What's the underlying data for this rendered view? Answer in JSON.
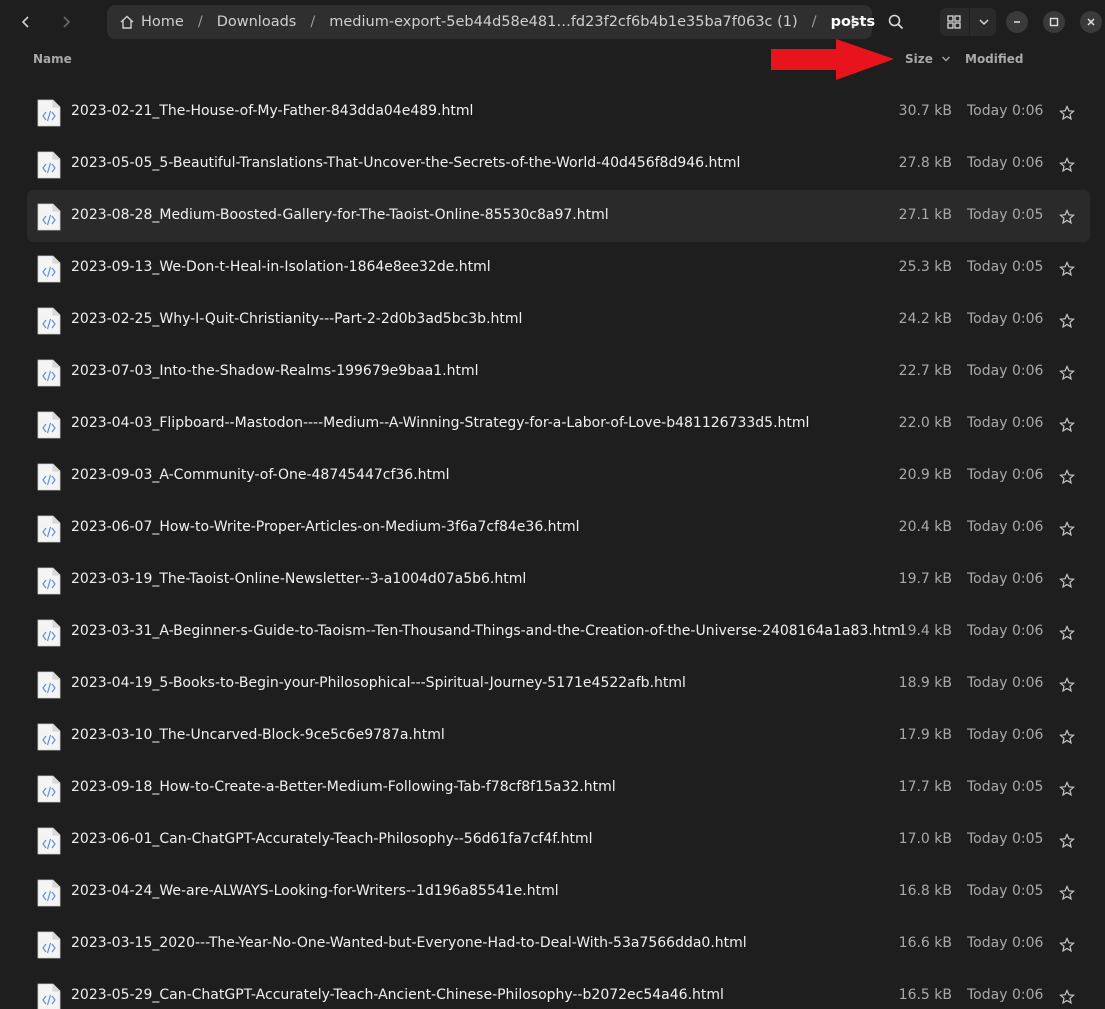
{
  "breadcrumb": {
    "items": [
      "Home",
      "Downloads",
      "medium-export-5eb44d58e481…fd23f2cf6b4b1e35ba7f063c (1)",
      "posts"
    ]
  },
  "columns": {
    "name": "Name",
    "size": "Size",
    "modified": "Modified"
  },
  "colors": {
    "background": "#1e1e1e",
    "pathbar": "#2f2f2f",
    "arrow": "#e8141c"
  },
  "files": [
    {
      "name": "2023-02-21_The-House-of-My-Father-843dda04e489.html",
      "size": "30.7 kB",
      "modified": "Today 0:06"
    },
    {
      "name": "2023-05-05_5-Beautiful-Translations-That-Uncover-the-Secrets-of-the-World-40d456f8d946.html",
      "size": "27.8 kB",
      "modified": "Today 0:06"
    },
    {
      "name": "2023-08-28_Medium-Boosted-Gallery-for-The-Taoist-Online-85530c8a97.html",
      "size": "27.1 kB",
      "modified": "Today 0:05"
    },
    {
      "name": "2023-09-13_We-Don-t-Heal-in-Isolation-1864e8ee32de.html",
      "size": "25.3 kB",
      "modified": "Today 0:05"
    },
    {
      "name": "2023-02-25_Why-I-Quit-Christianity---Part-2-2d0b3ad5bc3b.html",
      "size": "24.2 kB",
      "modified": "Today 0:06"
    },
    {
      "name": "2023-07-03_Into-the-Shadow-Realms-199679e9baa1.html",
      "size": "22.7 kB",
      "modified": "Today 0:06"
    },
    {
      "name": "2023-04-03_Flipboard--Mastodon----Medium--A-Winning-Strategy-for-a-Labor-of-Love-b481126733d5.html",
      "size": "22.0 kB",
      "modified": "Today 0:06"
    },
    {
      "name": "2023-09-03_A-Community-of-One-48745447cf36.html",
      "size": "20.9 kB",
      "modified": "Today 0:06"
    },
    {
      "name": "2023-06-07_How-to-Write-Proper-Articles-on-Medium-3f6a7cf84e36.html",
      "size": "20.4 kB",
      "modified": "Today 0:06"
    },
    {
      "name": "2023-03-19_The-Taoist-Online-Newsletter--3-a1004d07a5b6.html",
      "size": "19.7 kB",
      "modified": "Today 0:06"
    },
    {
      "name": "2023-03-31_A-Beginner-s-Guide-to-Taoism--Ten-Thousand-Things-and-the-Creation-of-the-Universe-2408164a1a83.html",
      "size": "19.4 kB",
      "modified": "Today 0:06"
    },
    {
      "name": "2023-04-19_5-Books-to-Begin-your-Philosophical---Spiritual-Journey-5171e4522afb.html",
      "size": "18.9 kB",
      "modified": "Today 0:06"
    },
    {
      "name": "2023-03-10_The-Uncarved-Block-9ce5c6e9787a.html",
      "size": "17.9 kB",
      "modified": "Today 0:06"
    },
    {
      "name": "2023-09-18_How-to-Create-a-Better-Medium-Following-Tab-f78cf8f15a32.html",
      "size": "17.7 kB",
      "modified": "Today 0:05"
    },
    {
      "name": "2023-06-01_Can-ChatGPT-Accurately-Teach-Philosophy--56d61fa7cf4f.html",
      "size": "17.0 kB",
      "modified": "Today 0:05"
    },
    {
      "name": "2023-04-24_We-are-ALWAYS-Looking-for-Writers--1d196a85541e.html",
      "size": "16.8 kB",
      "modified": "Today 0:05"
    },
    {
      "name": "2023-03-15_2020---The-Year-No-One-Wanted-but-Everyone-Had-to-Deal-With-53a7566dda0.html",
      "size": "16.6 kB",
      "modified": "Today 0:06"
    },
    {
      "name": "2023-05-29_Can-ChatGPT-Accurately-Teach-Ancient-Chinese-Philosophy--b2072ec54a46.html",
      "size": "16.5 kB",
      "modified": "Today 0:06"
    }
  ]
}
